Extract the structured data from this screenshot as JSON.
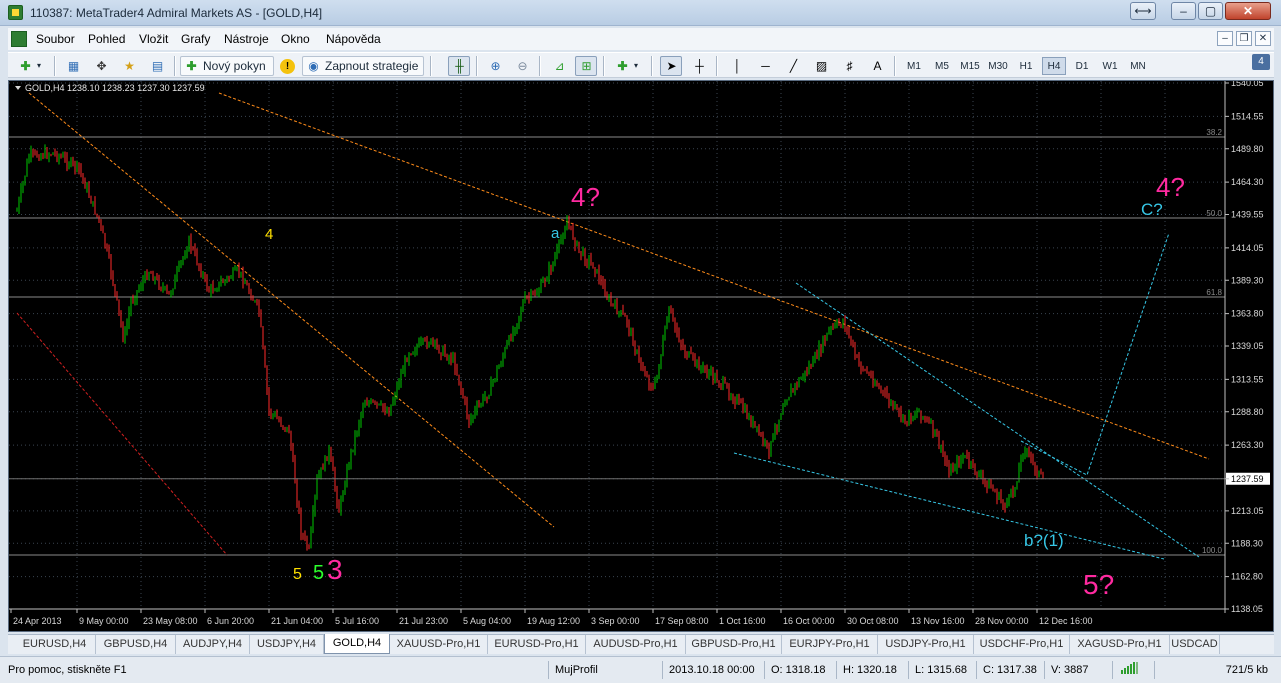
{
  "window": {
    "title": "110387: MetaTrader4 Admiral Markets AS - [GOLD,H4]"
  },
  "menu": [
    "Soubor",
    "Pohled",
    "Vložit",
    "Grafy",
    "Nástroje",
    "Okno",
    "Nápověda"
  ],
  "toolbar": {
    "new_order": "Nový pokyn",
    "expert": "Zapnout strategie",
    "text_tool": "A",
    "timeframes": [
      "M1",
      "M5",
      "M15",
      "M30",
      "H1",
      "H4",
      "D1",
      "W1",
      "MN"
    ],
    "active_timeframe": "H4"
  },
  "side_badge": "4",
  "chart": {
    "header": "GOLD,H4  1238.10 1238.23 1237.30 1237.59",
    "price_labels": [
      "1540.05",
      "1514.55",
      "1489.80",
      "1464.30",
      "1439.55",
      "1414.05",
      "1389.30",
      "1363.80",
      "1339.05",
      "1313.55",
      "1288.80",
      "1263.30",
      "1237.59",
      "1213.05",
      "1188.30",
      "1162.80",
      "1138.05"
    ],
    "current_price": "1237.59",
    "time_labels": [
      "24 Apr 2013",
      "9 May 00:00",
      "23 May 08:00",
      "6 Jun 20:00",
      "21 Jun 04:00",
      "5 Jul 16:00",
      "21 Jul 23:00",
      "5 Aug 04:00",
      "19 Aug 12:00",
      "3 Sep 00:00",
      "17 Sep 08:00",
      "1 Oct 16:00",
      "16 Oct 00:00",
      "30 Oct 08:00",
      "13 Nov 16:00",
      "28 Nov 00:00",
      "12 Dec 16:00"
    ],
    "fib_levels": [
      "38.2",
      "50.0",
      "61.8",
      "100.0"
    ],
    "annotations": [
      "4",
      "a",
      "4?",
      "C?",
      "4?",
      "5",
      "5",
      "3",
      "b?(1)",
      "5?"
    ],
    "colors": {
      "bull": "#00c800",
      "bear": "#ff2a2a",
      "grid": "#3a4450",
      "trend_orange": "#ff8c1a",
      "trend_red": "#d12020",
      "channel_cyan": "#36c7e6",
      "annotation_magenta": "#ff2aa0",
      "annotation_yellow": "#ffe000",
      "annotation_green": "#2cff2c"
    }
  },
  "tabs": [
    "EURUSD,H4",
    "GBPUSD,H4",
    "AUDJPY,H4",
    "USDJPY,H4",
    "GOLD,H4",
    "XAUUSD-Pro,H1",
    "EURUSD-Pro,H1",
    "AUDUSD-Pro,H1",
    "GBPUSD-Pro,H1",
    "EURJPY-Pro,H1",
    "USDJPY-Pro,H1",
    "USDCHF-Pro,H1",
    "XAGUSD-Pro,H1",
    "USDCAD"
  ],
  "active_tab": "GOLD,H4",
  "status": {
    "help": "Pro pomoc, stiskněte F1",
    "profile": "MujProfil",
    "datetime": "2013.10.18 00:00",
    "open": "O: 1318.18",
    "high": "H: 1320.18",
    "low": "L: 1315.68",
    "close": "C: 1317.38",
    "volume": "V: 3887",
    "traffic": "721/5 kb"
  }
}
